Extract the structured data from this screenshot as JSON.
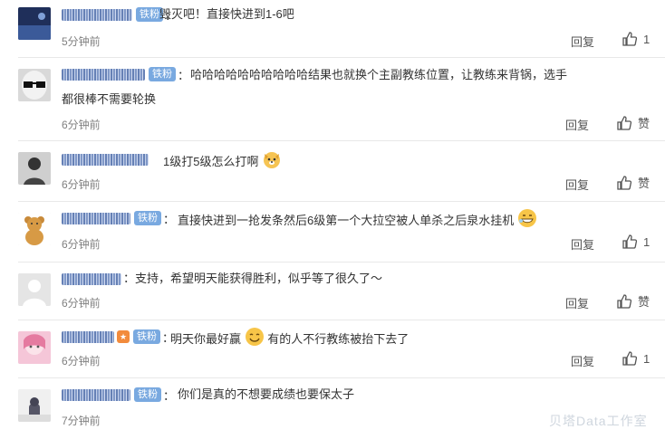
{
  "comments": [
    {
      "badge": "铁粉",
      "text": "毁灭吧！直接快进到1-6吧",
      "time": "5分钟前",
      "reply": "回复",
      "like": "1"
    },
    {
      "badge": "铁粉",
      "text_line1": "哈哈哈哈哈哈哈哈哈哈结果也就换个主副教练位置，让教练来背锅，选手",
      "text_line2": "都很棒不需要轮换",
      "time": "6分钟前",
      "reply": "回复",
      "like": "赞"
    },
    {
      "text": "1级打5级怎么打啊",
      "time": "6分钟前",
      "reply": "回复",
      "like": "赞"
    },
    {
      "badge": "铁粉",
      "text": "直接快进到一抢发条然后6级第一个大拉空被人单杀之后泉水挂机",
      "time": "6分钟前",
      "reply": "回复",
      "like": "1"
    },
    {
      "text": "：支持，希望明天能获得胜利，似乎等了很久了～",
      "time": "6分钟前",
      "reply": "回复",
      "like": "赞"
    },
    {
      "badge": "铁粉",
      "text_a": "明天你最好赢",
      "text_b": "有的人不行教练被抬下去了",
      "time": "6分钟前",
      "reply": "回复",
      "like": "1"
    },
    {
      "badge": "铁粉",
      "text": "你们是真的不想要成绩也要保太子",
      "time": "7分钟前"
    }
  ],
  "watermark": "贝塔Data工作室",
  "icons": {
    "like": "thumbs-up-icon",
    "emoji_laugh": "grin-face-icon",
    "emoji_smile": "smile-face-icon",
    "emoji_dog": "dog-face-icon"
  }
}
